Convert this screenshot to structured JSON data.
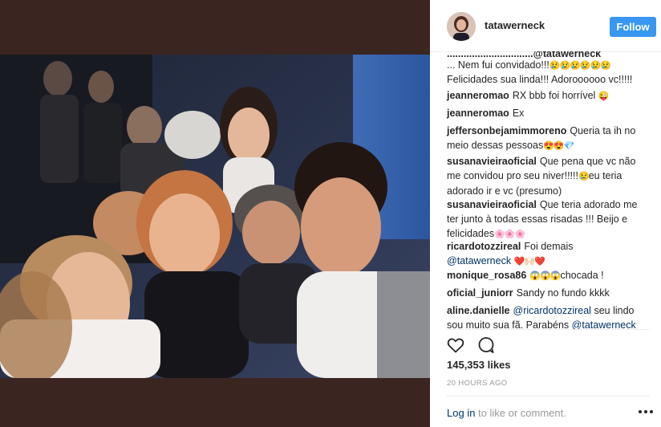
{
  "post": {
    "username": "tatawerneck",
    "follow_label": "Follow",
    "likes": "145,353 likes",
    "time": "20 HOURS AGO",
    "login_label": "Log in",
    "login_suffix": " to like or comment.",
    "photo_alt_icon": "group-selfie-photo"
  },
  "comments": [
    {
      "user": "",
      "text": "... Nem fui convidado!!!",
      "emoji": "😢😢😢😢😢😢",
      "tail": "",
      "partial_top": "...............................@tatawerneck"
    },
    {
      "user": "",
      "text": "Felicidades sua linda!!! Adoroooooo vc!!!!!",
      "emoji": "",
      "tail": ""
    },
    {
      "user": "jeanneromao",
      "text": "RX bbb foi horrível",
      "emoji": "😜",
      "tail": ""
    },
    {
      "user": "jeanneromao",
      "text": "Ex",
      "emoji": "",
      "tail": ""
    },
    {
      "user": "jeffersonbejamimmoreno",
      "text": "Queria ta ih no meio dessas pessoas",
      "emoji": "😍😍💎",
      "tail": ""
    },
    {
      "user": "susanavieiraoficial",
      "text": "Que pena que vc não me convidou pro seu niver!!!!!",
      "emoji": "😢",
      "tail": "eu teria adorado ir e vc (presumo)"
    },
    {
      "user": "susanavieiraoficial",
      "text": "Que teria adorado me ter junto à todas essas risadas !!! Beijo e felicidades",
      "emoji": "🌸🌸🌸",
      "tail": ""
    },
    {
      "user": "ricardotozzireal",
      "text": "Foi demais",
      "mention": "@tatawerneck",
      "emoji": "❤️🙌🏻❤️",
      "tail": ""
    },
    {
      "user": "monique_rosa86",
      "text": "chocada !",
      "emoji": "😱😱😱",
      "tail": ""
    },
    {
      "user": "oficial_juniorr",
      "text": "Sandy no fundo kkkk",
      "emoji": "",
      "tail": ""
    },
    {
      "user": "aline.danielle",
      "mention": "@ricardotozzireal",
      "text": "seu lindo sou muito sua fã. Parabéns",
      "mention2": "@tatawerneck",
      "emoji": "",
      "tail": ""
    }
  ],
  "colors": {
    "follow_bg": "#3897f0",
    "backdrop": "#3b2521",
    "mention": "#003569"
  },
  "icons": {
    "like": "heart-icon",
    "comment": "comment-bubble-icon",
    "more": "more-options-icon"
  }
}
